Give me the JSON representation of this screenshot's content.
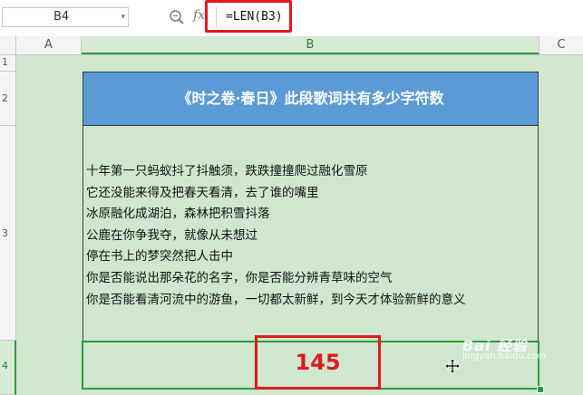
{
  "formula_bar": {
    "cell_ref": "B4",
    "fx_label": "fx",
    "formula": "=LEN(B3)"
  },
  "columns": {
    "a": "A",
    "b": "B",
    "c": "C"
  },
  "rows": [
    "1",
    "2",
    "3",
    "4"
  ],
  "sheet": {
    "title": "《时之卷·春日》此段歌词共有多少字符数",
    "lyrics": [
      "十年第一只蚂蚁抖了抖触须，跌跌撞撞爬过融化雪原",
      "它还没能来得及把春天看清，去了谁的嘴里",
      "冰原融化成湖泊，森林把积雪抖落",
      "公鹿在你争我夺，就像从未想过",
      "停在书上的梦突然把人击中",
      "你是否能说出那朵花的名字，你是否能分辨青草味的空气",
      "你是否能看清河流中的游鱼，一切都太新鲜，到今天才体验新鲜的意义"
    ],
    "result": "145"
  },
  "colors": {
    "header_blue": "#5b9bd5",
    "selection_green": "#2e9a3e",
    "highlight_red": "#e2191c",
    "sheet_bg": "#cfe7cf"
  },
  "watermark": {
    "text": "Bai 经验",
    "sub": "jingyan.baidu.com"
  }
}
